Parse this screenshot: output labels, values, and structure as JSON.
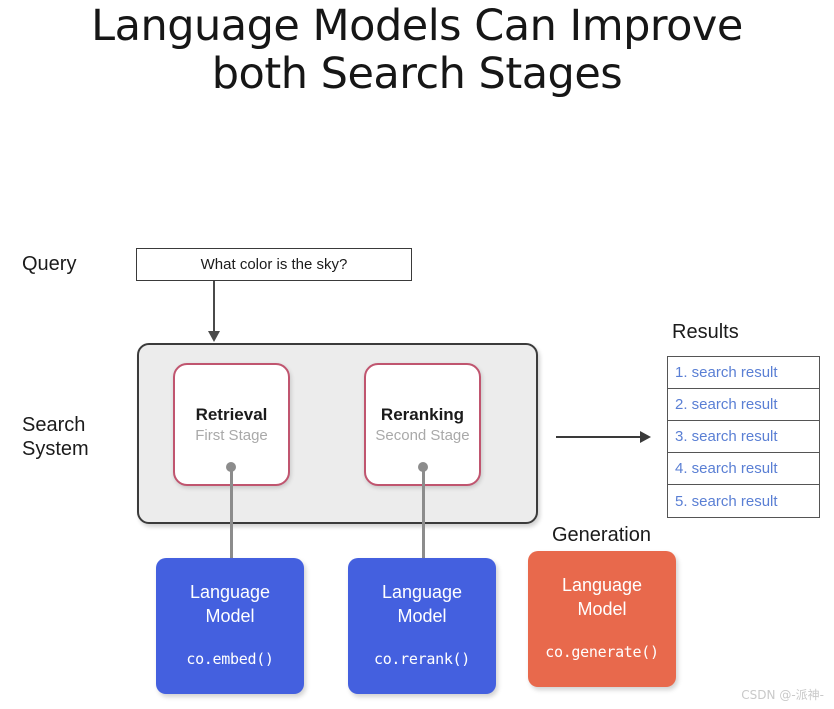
{
  "title": {
    "line1": "Language Models Can Improve",
    "line2": "both Search Stages"
  },
  "labels": {
    "query": "Query",
    "search_system": "Search\nSystem",
    "results": "Results",
    "generation": "Generation"
  },
  "query_box": {
    "text": "What color is the sky?"
  },
  "stages": [
    {
      "title": "Retrieval",
      "subtitle": "First Stage"
    },
    {
      "title": "Reranking",
      "subtitle": "Second Stage"
    }
  ],
  "models": [
    {
      "name": "Language\nModel",
      "api": "co.embed()",
      "color": "#4460df"
    },
    {
      "name": "Language\nModel",
      "api": "co.rerank()",
      "color": "#4460df"
    },
    {
      "name": "Language\nModel",
      "api": "co.generate()",
      "color": "#e8694c"
    }
  ],
  "results": [
    "1. search result",
    "2. search result",
    "3. search result",
    "4. search result",
    "5. search result"
  ],
  "watermark": "CSDN @-派神-",
  "colors": {
    "model_blue": "#4460df",
    "model_orange": "#e8694c",
    "stage_border_pink": "#c0556f",
    "system_fill_gray": "#ececec",
    "result_text_blue": "#5a7fd4"
  }
}
